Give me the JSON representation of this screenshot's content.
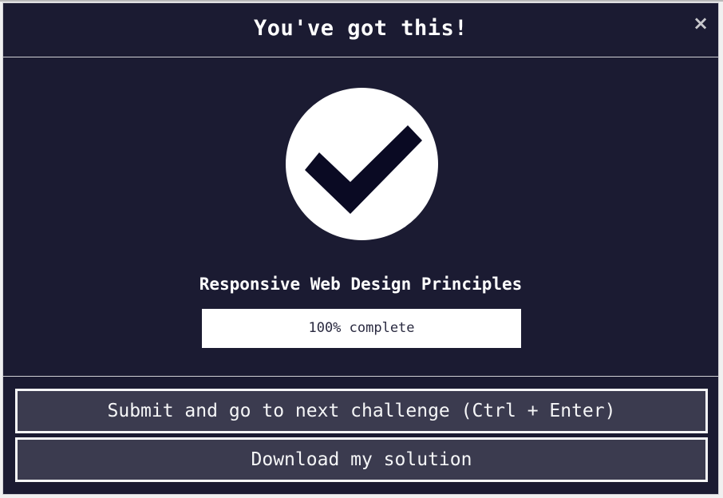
{
  "modal": {
    "title": "You've got this!",
    "close_symbol": "×",
    "close_icon": "close-icon",
    "check_icon": "checkmark-icon",
    "course_title": "Responsive Web Design Principles",
    "progress": {
      "percent": 100,
      "label": "100% complete"
    },
    "buttons": {
      "submit_label": "Submit and go to next challenge (Ctrl + Enter)",
      "download_label": "Download my solution"
    }
  },
  "colors": {
    "modal_bg": "#1b1b32",
    "button_bg": "#3b3b4f",
    "text": "#f5f6f7",
    "check_dark": "#0a0a23"
  }
}
